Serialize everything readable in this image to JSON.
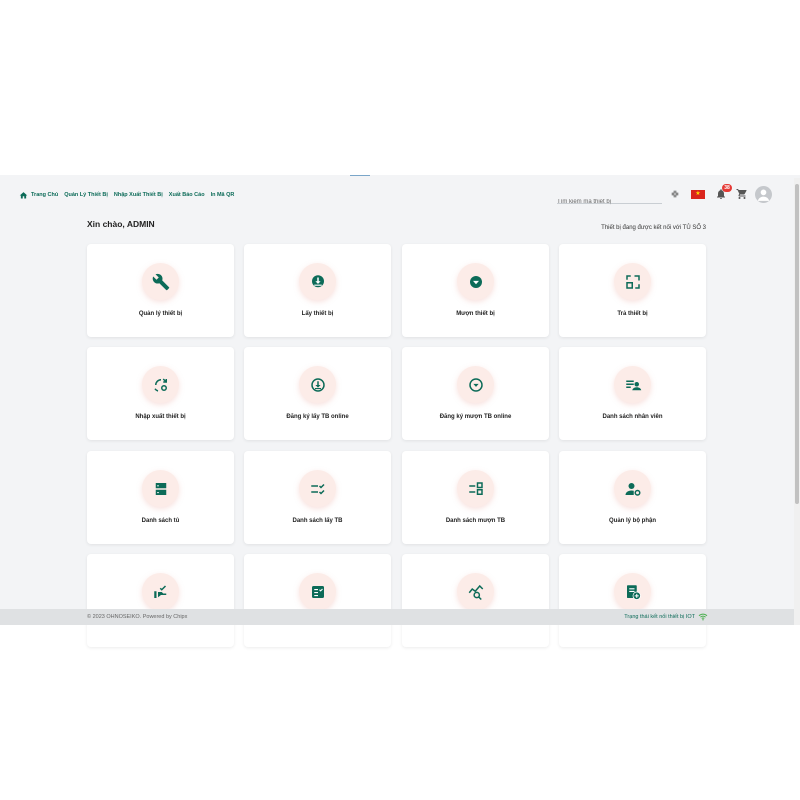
{
  "colors": {
    "accent": "#0c6b58",
    "card_bg": "#ffffff",
    "icon_circle": "#fcece8",
    "badge": "#e53935"
  },
  "nav": {
    "home": "Trang Chủ",
    "devices": "Quản Lý Thiết Bị",
    "import_export": "Nhập Xuất Thiết Bị",
    "reports": "Xuất Báo Cáo",
    "qr": "In Mã QR"
  },
  "search": {
    "placeholder": "Tìm kiếm mã thiết bị"
  },
  "header": {
    "notification_count": "38"
  },
  "greeting": "Xin chào, ADMIN",
  "connection": "Thiết bị đang được kết nối với TỦ SỐ 3",
  "cards": [
    {
      "label": "Quản lý thiết bị",
      "icon": "tools-icon"
    },
    {
      "label": "Lấy thiết bị",
      "icon": "download-icon"
    },
    {
      "label": "Mượn thiết bị",
      "icon": "arrow-down-circle-icon"
    },
    {
      "label": "Trả thiết bị",
      "icon": "return-icon"
    },
    {
      "label": "Nhập xuất thiết bị",
      "icon": "sync-settings-icon"
    },
    {
      "label": "Đăng ký lấy TB online",
      "icon": "download-circle-icon"
    },
    {
      "label": "Đăng ký mượn TB online",
      "icon": "chevron-circle-icon"
    },
    {
      "label": "Danh sách nhân viên",
      "icon": "person-list-icon"
    },
    {
      "label": "Danh sách tủ",
      "icon": "cabinet-icon"
    },
    {
      "label": "Danh sách lấy TB",
      "icon": "checklist-icon"
    },
    {
      "label": "Danh sách mượn TB",
      "icon": "list-grid-icon"
    },
    {
      "label": "Quản lý bộ phận",
      "icon": "manage-accounts-icon"
    },
    {
      "label": "",
      "icon": "hand-check-icon"
    },
    {
      "label": "",
      "icon": "fact-check-icon"
    },
    {
      "label": "",
      "icon": "query-stats-icon"
    },
    {
      "label": "",
      "icon": "receipt-add-icon"
    }
  ],
  "footer": {
    "copyright": "© 2023 OHNOSEIKO. Powered by Chipx",
    "iot_status": "Trạng thái kết nối thiết bị IOT"
  }
}
